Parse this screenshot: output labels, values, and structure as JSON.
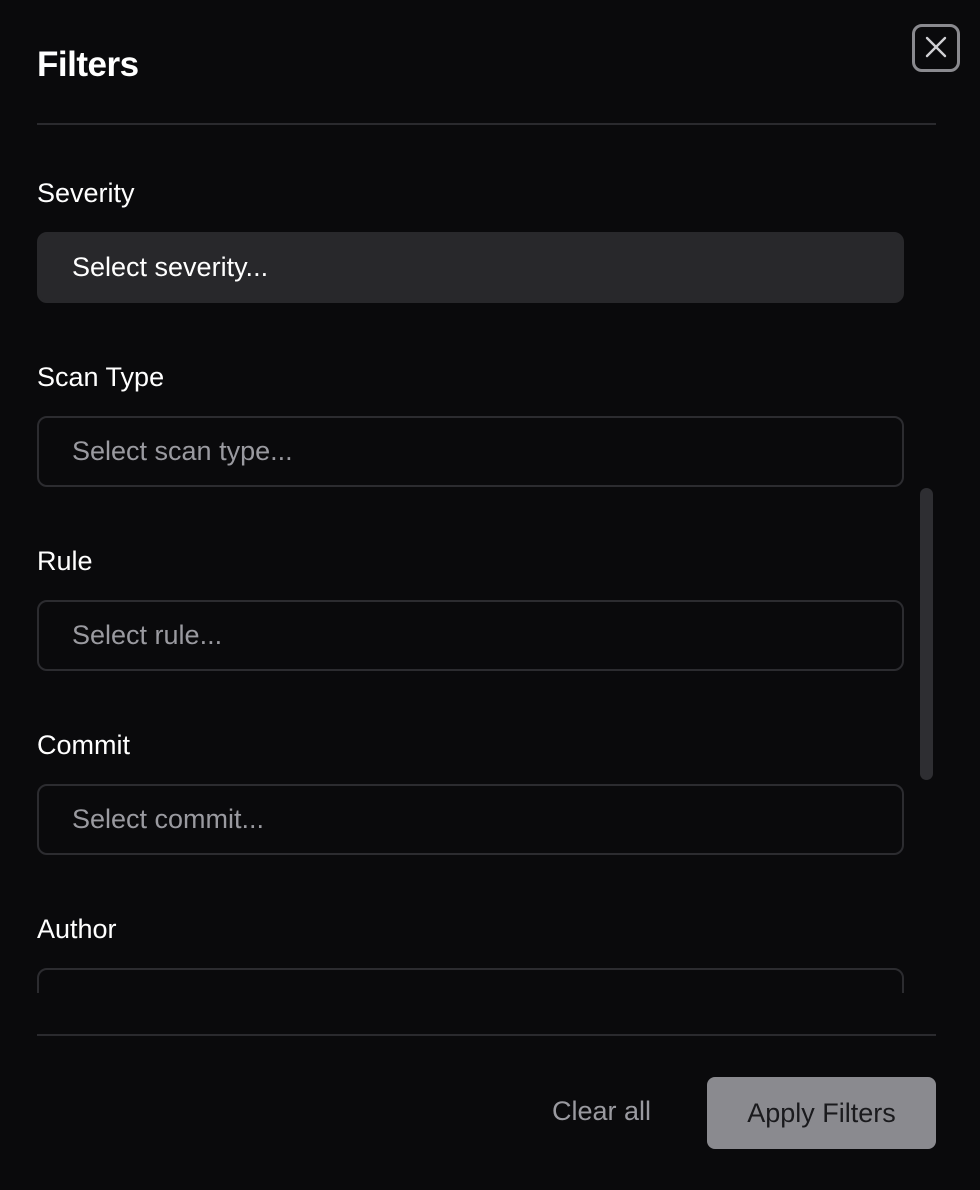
{
  "dialog": {
    "title": "Filters",
    "close_icon": "close-icon"
  },
  "fields": [
    {
      "label": "Severity",
      "placeholder": "Select severity...",
      "focused": true
    },
    {
      "label": "Scan Type",
      "placeholder": "Select scan type..."
    },
    {
      "label": "Rule",
      "placeholder": "Select rule..."
    },
    {
      "label": "Commit",
      "placeholder": "Select commit..."
    },
    {
      "label": "Author",
      "placeholder": ""
    }
  ],
  "footer": {
    "clear_label": "Clear all",
    "apply_label": "Apply Filters"
  },
  "colors": {
    "background": "#0a0a0c",
    "focused_field": "#28282b",
    "apply_button": "#8a8a8f",
    "muted_text": "#9a9aa0"
  }
}
